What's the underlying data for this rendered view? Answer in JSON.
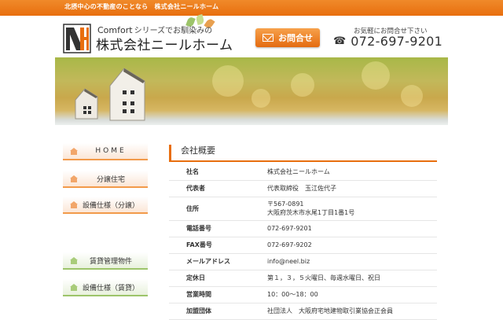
{
  "top_bar": {
    "text": "北摂中心の不動産のことなら　株式会社ニールホーム"
  },
  "header": {
    "tagline_en": "Comfort",
    "tagline_jp": "シリーズでお馴染みの",
    "company_name": "株式会社ニールホーム",
    "contact_button_label": "お問合せ",
    "call_note": "お気軽にお問合せ下さい",
    "phone_number": "072-697-9201"
  },
  "sidebar": {
    "items": [
      {
        "label": "HOME"
      },
      {
        "label": "分譲住宅"
      },
      {
        "label": "設備仕様（分譲）"
      },
      {
        "label": "賃貸管理物件"
      },
      {
        "label": "設備仕様（賃貸）"
      }
    ]
  },
  "main": {
    "section_title": "会社概要",
    "rows": [
      {
        "label": "社名",
        "value": "株式会社ニールホーム"
      },
      {
        "label": "代表者",
        "value": "代表取締役　玉江佐代子"
      },
      {
        "label": "住所",
        "value": "〒567-0891",
        "value2": "大阪府茨木市水尾1丁目1番1号"
      },
      {
        "label": "電話番号",
        "value": "072-697-9201"
      },
      {
        "label": "FAX番号",
        "value": "072-697-9202"
      },
      {
        "label": "メールアドレス",
        "value": "info@neel.biz"
      },
      {
        "label": "定休日",
        "value": "第１，３，５火曜日、毎週水曜日、祝日"
      },
      {
        "label": "営業時間",
        "value": "10：00〜18：00"
      },
      {
        "label": "加盟団体",
        "value": "社団法人　大阪府宅地建物取引業協会正会員"
      }
    ]
  },
  "colors": {
    "accent": "#e86e0e",
    "green_accent": "#9dc46a"
  }
}
